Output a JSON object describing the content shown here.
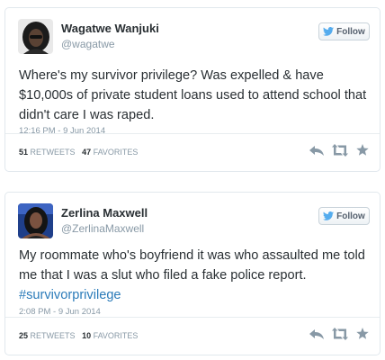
{
  "tweets": [
    {
      "name": "Wagatwe Wanjuki",
      "handle": "@wagatwe",
      "text": "Where's my survivor privilege? Was expelled & have $10,000s of private student loans used to attend school that didn't care I was raped.",
      "hashtag": "",
      "timestamp": "12:16 PM - 9 Jun 2014",
      "retweets": "51",
      "retweets_label": "RETWEETS",
      "favorites": "47",
      "favorites_label": "FAVORITES"
    },
    {
      "name": "Zerlina Maxwell",
      "handle": "@ZerlinaMaxwell",
      "text": "My roommate who's boyfriend it was who assaulted me told me that I was a slut who filed a fake police report.",
      "hashtag": "#survivorprivilege",
      "timestamp": "2:08 PM - 9 Jun 2014",
      "retweets": "25",
      "retweets_label": "RETWEETS",
      "favorites": "10",
      "favorites_label": "FAVORITES"
    }
  ],
  "follow_label": "Follow",
  "icons": {
    "bird": "twitter-bird-icon",
    "reply": "reply-icon",
    "retweet": "retweet-icon",
    "favorite": "star-icon"
  },
  "colors": {
    "link": "#2b7bb9",
    "bird": "#55acee",
    "muted": "#8899a6",
    "text": "#292f33",
    "action_icon": "#8899a6"
  }
}
